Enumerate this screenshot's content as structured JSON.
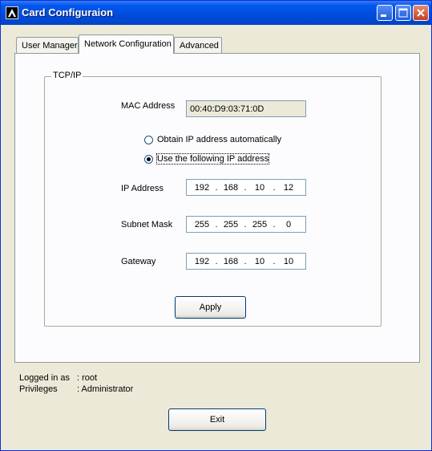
{
  "window": {
    "title": "Card Configuraion",
    "title_icon": "app-logo-icon",
    "controls": [
      "minimize-icon",
      "maximize-icon",
      "close-icon"
    ]
  },
  "tabs": [
    {
      "label": "User Manager",
      "active": false
    },
    {
      "label": "Network Configuration",
      "active": true
    },
    {
      "label": "Advanced",
      "active": false
    }
  ],
  "tcpip": {
    "group_label": "TCP/IP",
    "mac_label": "MAC Address",
    "mac_value": "00:40:D9:03:71:0D",
    "radio_auto": "Obtain IP address automatically",
    "radio_manual": "Use the following IP address",
    "selected": "manual",
    "ip_label": "IP Address",
    "ip": [
      "192",
      "168",
      "10",
      "12"
    ],
    "subnet_label": "Subnet Mask",
    "subnet": [
      "255",
      "255",
      "255",
      "0"
    ],
    "gateway_label": "Gateway",
    "gateway": [
      "192",
      "168",
      "10",
      "10"
    ],
    "apply_label": "Apply"
  },
  "status": {
    "logged_in_label": "Logged in as",
    "logged_in_value": ": root",
    "privileges_label": "Privileges",
    "privileges_value": ": Administrator"
  },
  "exit_label": "Exit"
}
